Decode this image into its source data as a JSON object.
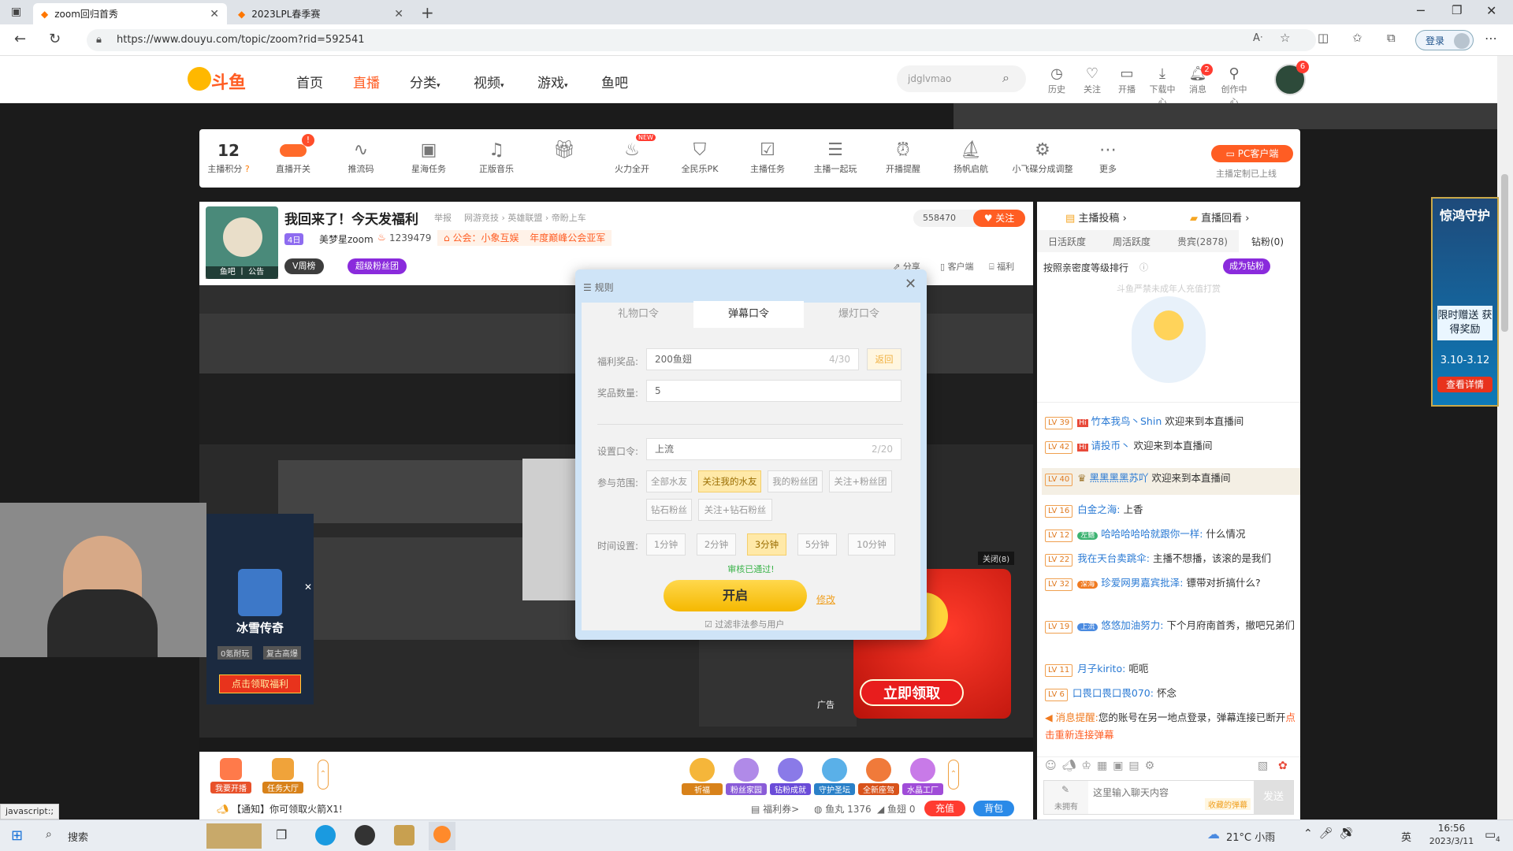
{
  "browser": {
    "tabs": [
      {
        "title": "zoom回归首秀",
        "active": true
      },
      {
        "title": "2023LPL春季赛",
        "active": false
      }
    ],
    "url": "https://www.douyu.com/topic/zoom?rid=592541",
    "login_label": "登录"
  },
  "site": {
    "logo_text": "斗鱼",
    "nav": [
      "首页",
      "直播",
      "分类",
      "视频",
      "游戏",
      "鱼吧"
    ],
    "search_value": "jdglvmao",
    "header_icons": [
      "历史",
      "关注",
      "开播",
      "下载中心",
      "消息",
      "创作中心"
    ],
    "messages_badge": "2",
    "avatar_badge": "6"
  },
  "toolbar": {
    "score_value": "12",
    "score_label": "主播积分",
    "items": [
      "直播开关",
      "推流码",
      "星海任务",
      "正版音乐",
      "",
      "火力全开",
      "全民乐PK",
      "主播任务",
      "主播一起玩",
      "开播提醒",
      "扬帆启航",
      "小飞碟分成调整",
      "更多"
    ],
    "new_tag": "NEW",
    "pc_client": "PC客户端",
    "pc_client_sub": "主播定制已上线"
  },
  "room": {
    "title": "我回来了！今天发福利",
    "report": "举报",
    "categories": "网游竞技 › 英雄联盟 › 帝盼上车",
    "level_badge": "4日",
    "anchor_name": "美梦星zoom",
    "heat": "1239479",
    "guild_label": "公会：小象互娱",
    "guild_award": "年度巅峰公会亚军",
    "avatar_tags": "鱼吧 丨 公告",
    "vweek": "V周榜",
    "super_fans": "超级粉丝团",
    "follow_count": "558470",
    "follow_label": "关注",
    "share": "分享",
    "client": "客户端",
    "welfare": "福利"
  },
  "modal": {
    "title": "规则",
    "tabs": [
      "礼物口令",
      "弹幕口令",
      "爆灯口令"
    ],
    "active_tab": 1,
    "prize_label": "福利奖品:",
    "prize_value": "200鱼翅",
    "prize_count": "4/30",
    "back_label": "返回",
    "qty_label": "奖品数量:",
    "qty_value": "5",
    "cmd_label": "设置口令:",
    "cmd_value": "上流",
    "cmd_count": "2/20",
    "scope_label": "参与范围:",
    "scopes": [
      "全部水友",
      "关注我的水友",
      "我的粉丝团",
      "关注+粉丝团",
      "钻石粉丝",
      "关注+钻石粉丝"
    ],
    "scope_selected": 1,
    "time_label": "时间设置:",
    "times": [
      "1分钟",
      "2分钟",
      "3分钟",
      "5分钟",
      "10分钟"
    ],
    "time_selected": 2,
    "approved": "审核已通过!",
    "start": "开启",
    "modify": "修改",
    "filter": "过滤非法参与用户"
  },
  "ad": {
    "claim": "立即领取",
    "ad_label": "广告",
    "close": "关闭(8)"
  },
  "left_ad": {
    "game": "冰雪传奇",
    "tags": [
      "0氪耐玩",
      "复古高爆"
    ],
    "cta": "点击领取福利"
  },
  "right_ad": {
    "title": "惊鸿守护",
    "sub": "限时赠送 获得奖励",
    "dates": "3.10-3.12",
    "cta": "查看详情"
  },
  "rightpanel": {
    "top_links": [
      "主播投稿",
      "直播回看"
    ],
    "rank_tabs": [
      "日活跃度",
      "周活跃度",
      "贵宾(2878)",
      "钻粉(0)"
    ],
    "rank_desc": "按照亲密度等级排行",
    "become_diamond": "成为钻粉",
    "minor_notice": "斗鱼严禁未成年人充值打赏"
  },
  "chat": [
    {
      "lv": "LV 39",
      "name": "竹本我鸟丶Shin",
      "text": "欢迎来到本直播间"
    },
    {
      "lv": "LV 42",
      "name": "请投币丶",
      "text": "欢迎来到本直播间"
    },
    {
      "lv": "LV 40",
      "name": "黑黑黑黑苏吖",
      "text": "欢迎来到本直播间"
    },
    {
      "lv": "LV 16",
      "name": "白金之海:",
      "text": "上香"
    },
    {
      "lv": "LV 12",
      "name": "哈哈哈哈哈就跟你一样:",
      "text": "什么情况"
    },
    {
      "lv": "LV 22",
      "name": "我在天台卖跳伞:",
      "text": "主播不想播，该滚的是我们"
    },
    {
      "lv": "LV 32",
      "name": "珍爱网男嘉宾批泽:",
      "text": "镖带对折搞什么?"
    },
    {
      "lv": "LV 19",
      "name": "悠悠加油努力:",
      "text": "下个月府南首秀，撤吧兄弟们"
    },
    {
      "lv": "LV 11",
      "name": "月子kirito:",
      "text": "呃呃"
    },
    {
      "lv": "LV 6",
      "name": "口畏口畏口畏070:",
      "text": "怀念"
    }
  ],
  "chat_badges": [
    "深海",
    "左鳍",
    "深海",
    "上流"
  ],
  "system_msg": {
    "label": "消息提醒:",
    "text": "您的账号在另一地点登录，弹幕连接已断开",
    "link": "点击重新连接弹幕"
  },
  "chat_input": {
    "placeholder": "这里输入聊天内容",
    "hint": "收藏的弹幕",
    "send": "发送",
    "not_owned": "未拥有"
  },
  "bottombar": {
    "left_btns": [
      "我要开播",
      "任务大厅"
    ],
    "gifts": [
      "祈福",
      "粉丝家园",
      "钻粉成就",
      "守护圣坛",
      "全新座驾",
      "水晶工厂"
    ],
    "notice": "【通知】你可领取火箭X1!",
    "coupon": "福利券>",
    "fish_pill_label": "鱼丸",
    "fish_pill": "1376",
    "fish_fin_label": "鱼翅",
    "fish_fin": "0",
    "recharge": "充值",
    "backpack": "背包"
  },
  "status_url": "javascript:;",
  "taskbar": {
    "search": "搜索",
    "weather": "21°C 小雨",
    "ime": "英",
    "time": "16:56",
    "date": "2023/3/11",
    "notif": "4"
  }
}
